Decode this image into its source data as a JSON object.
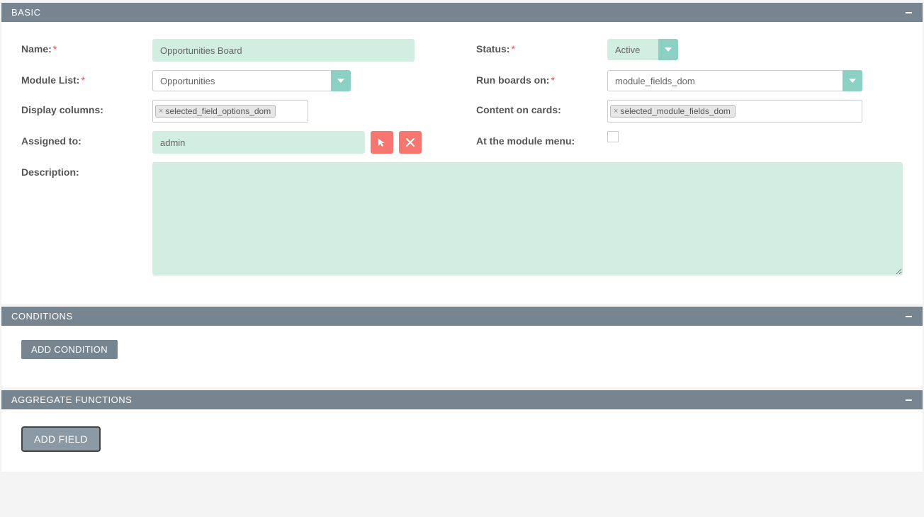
{
  "panels": {
    "basic": {
      "title": "BASIC"
    },
    "conditions": {
      "title": "CONDITIONS",
      "add_button": "ADD CONDITION"
    },
    "aggregate": {
      "title": "AGGREGATE FUNCTIONS",
      "add_button": "ADD FIELD"
    }
  },
  "labels": {
    "name": "Name:",
    "module_list": "Module List:",
    "display_columns": "Display columns:",
    "assigned_to": "Assigned to:",
    "description": "Description:",
    "status": "Status:",
    "run_boards_on": "Run boards on:",
    "content_on_cards": "Content on cards:",
    "at_module_menu": "At the module menu:"
  },
  "values": {
    "name": "Opportunities Board",
    "module_list": "Opportunities",
    "display_columns_tag": "selected_field_options_dom",
    "assigned_to": "admin",
    "description": "",
    "status": "Active",
    "run_boards_on": "module_fields_dom",
    "content_on_cards_tag": "selected_module_fields_dom"
  }
}
